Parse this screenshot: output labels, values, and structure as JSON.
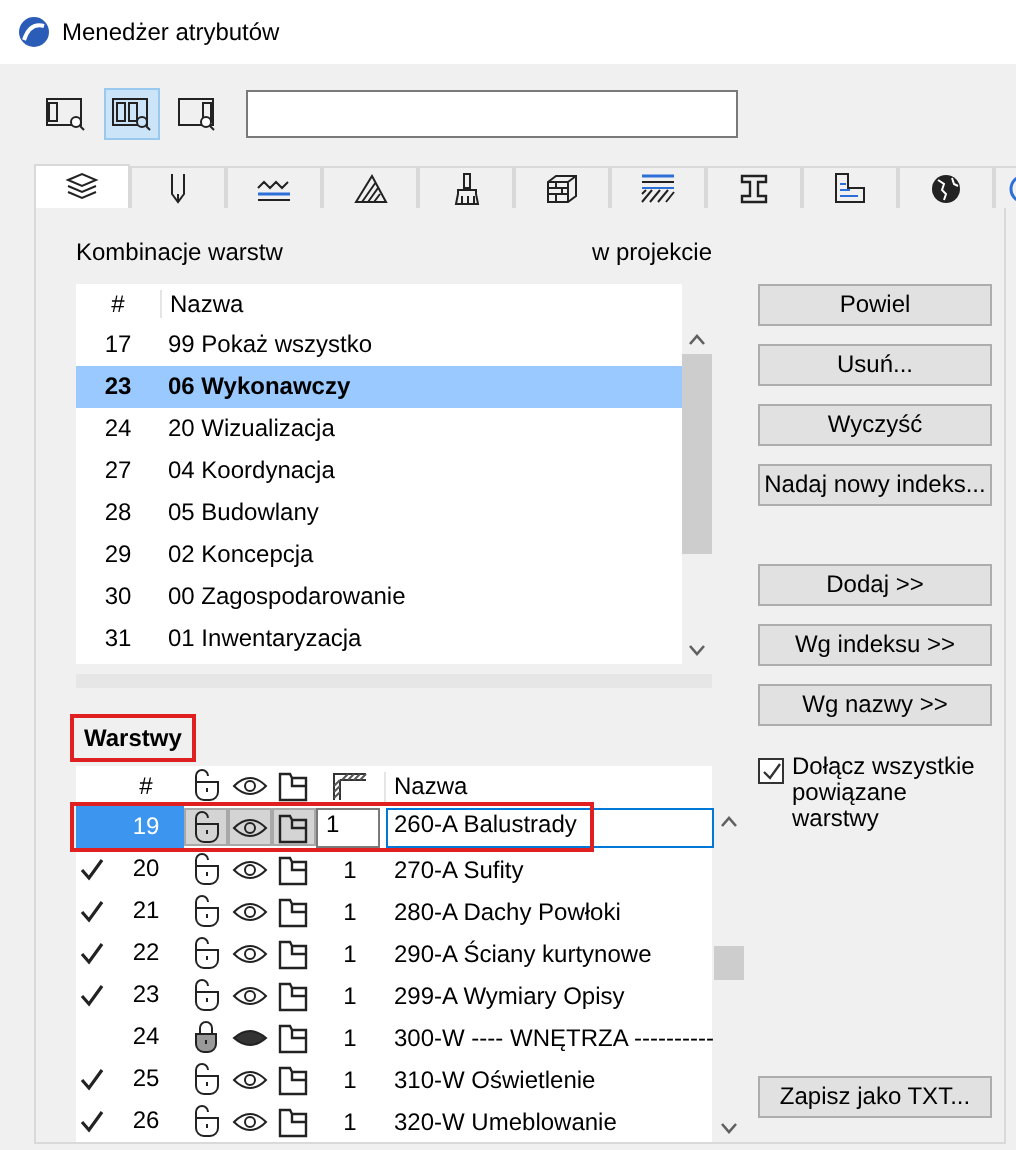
{
  "window": {
    "title": "Menedżer atrybutów"
  },
  "view_buttons": [
    {
      "selected": false
    },
    {
      "selected": true
    },
    {
      "selected": false
    }
  ],
  "tabs": [
    {
      "selected": true
    },
    {
      "selected": false
    },
    {
      "selected": false
    },
    {
      "selected": false
    },
    {
      "selected": false
    },
    {
      "selected": false
    },
    {
      "selected": false
    },
    {
      "selected": false
    },
    {
      "selected": false
    },
    {
      "selected": false
    },
    {
      "selected": false
    }
  ],
  "combinations": {
    "title": "Kombinacje warstw",
    "column_label": "w projekcie",
    "columns": [
      "#",
      "Nazwa"
    ],
    "rows": [
      {
        "index": "17",
        "name": "99 Pokaż wszystko",
        "selected": false
      },
      {
        "index": "23",
        "name": "06 Wykonawczy",
        "selected": true
      },
      {
        "index": "24",
        "name": "20 Wizualizacja",
        "selected": false
      },
      {
        "index": "27",
        "name": "04 Koordynacja",
        "selected": false
      },
      {
        "index": "28",
        "name": "05 Budowlany",
        "selected": false
      },
      {
        "index": "29",
        "name": "02 Koncepcja",
        "selected": false
      },
      {
        "index": "30",
        "name": "00 Zagospodarowanie",
        "selected": false
      },
      {
        "index": "31",
        "name": "01 Inwentaryzacja",
        "selected": false
      }
    ]
  },
  "layers": {
    "title": "Warstwy",
    "highlighted": true,
    "columns": [
      "#",
      "Nazwa"
    ],
    "rows": [
      {
        "checked": false,
        "index": "19",
        "locked": false,
        "visible": true,
        "pen": "1",
        "name": "260-A Balustrady",
        "selected": true
      },
      {
        "checked": true,
        "index": "20",
        "locked": false,
        "visible": true,
        "pen": "1",
        "name": "270-A Sufity",
        "selected": false
      },
      {
        "checked": true,
        "index": "21",
        "locked": false,
        "visible": true,
        "pen": "1",
        "name": "280-A Dachy Powłoki",
        "selected": false
      },
      {
        "checked": true,
        "index": "22",
        "locked": false,
        "visible": true,
        "pen": "1",
        "name": "290-A Ściany kurtynowe",
        "selected": false
      },
      {
        "checked": true,
        "index": "23",
        "locked": false,
        "visible": true,
        "pen": "1",
        "name": "299-A Wymiary Opisy",
        "selected": false
      },
      {
        "checked": false,
        "index": "24",
        "locked": true,
        "visible": false,
        "pen": "1",
        "name": "300-W ---- WNĘTRZA ----------",
        "selected": false
      },
      {
        "checked": true,
        "index": "25",
        "locked": false,
        "visible": true,
        "pen": "1",
        "name": "310-W Oświetlenie",
        "selected": false
      },
      {
        "checked": true,
        "index": "26",
        "locked": false,
        "visible": true,
        "pen": "1",
        "name": "320-W Umeblowanie",
        "selected": false
      }
    ]
  },
  "combination_buttons": [
    "Powiel",
    "Usuń...",
    "Wyczyść",
    "Nadaj nowy indeks..."
  ],
  "layer_buttons": [
    "Dodaj >>",
    "Wg indeksu >>",
    "Wg nazwy >>"
  ],
  "include_related": {
    "label": "Dołącz wszystkie powiązane warstwy",
    "checked": true
  },
  "export_button": "Zapisz jako TXT..."
}
